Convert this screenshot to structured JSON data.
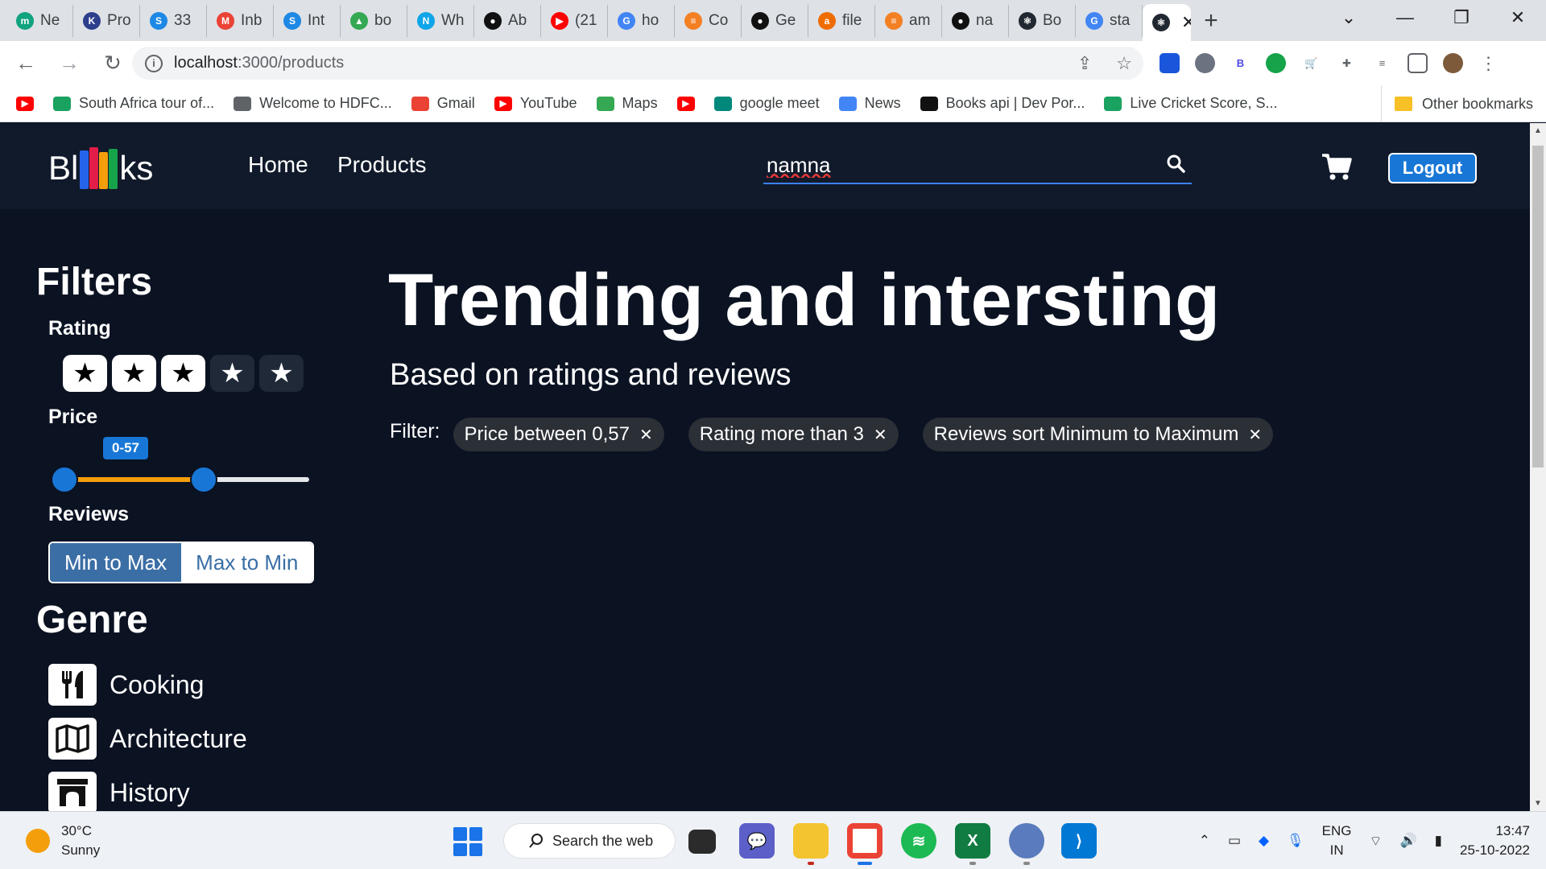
{
  "browser": {
    "tabs": [
      {
        "label": "Ne",
        "icon": "m-icon",
        "color": "#10a37f",
        "glyph": "m"
      },
      {
        "label": "Pro",
        "icon": "k-icon",
        "color": "#2c3e8c",
        "glyph": "K"
      },
      {
        "label": "33",
        "icon": "s-icon",
        "color": "#1e88e5",
        "glyph": "S"
      },
      {
        "label": "Inb",
        "icon": "gmail-icon",
        "color": "#ea4335",
        "glyph": "M"
      },
      {
        "label": "Int",
        "icon": "s-icon",
        "color": "#1e88e5",
        "glyph": "S"
      },
      {
        "label": "bo",
        "icon": "drive-icon",
        "color": "#34a853",
        "glyph": "▲"
      },
      {
        "label": "Wh",
        "icon": "n-icon",
        "color": "#0ea5e9",
        "glyph": "N"
      },
      {
        "label": "Ab",
        "icon": "github-icon",
        "color": "#111111",
        "glyph": "●"
      },
      {
        "label": "(21",
        "icon": "youtube-icon",
        "color": "#ff0000",
        "glyph": "▶"
      },
      {
        "label": "ho",
        "icon": "google-icon",
        "color": "#4285f4",
        "glyph": "G"
      },
      {
        "label": "Co",
        "icon": "stackoverflow-icon",
        "color": "#f48024",
        "glyph": "≡"
      },
      {
        "label": "Ge",
        "icon": "github-icon",
        "color": "#111111",
        "glyph": "●"
      },
      {
        "label": "file",
        "icon": "ask-icon",
        "color": "#ef6c00",
        "glyph": "a"
      },
      {
        "label": "am",
        "icon": "stackoverflow-icon",
        "color": "#f48024",
        "glyph": "≡"
      },
      {
        "label": "na",
        "icon": "github-icon",
        "color": "#111111",
        "glyph": "●"
      },
      {
        "label": "Bo",
        "icon": "react-icon",
        "color": "#222831",
        "glyph": "⚛"
      },
      {
        "label": "sta",
        "icon": "google-icon",
        "color": "#4285f4",
        "glyph": "G"
      }
    ],
    "active_tab_icon": "react-icon",
    "url_host": "localhost",
    "url_path": ":3000/products",
    "bookmarks": [
      {
        "label": "",
        "icon": "youtube-icon",
        "color": "#ff0000"
      },
      {
        "label": "South Africa tour of...",
        "icon": "cricbuzz-icon",
        "color": "#1aa260"
      },
      {
        "label": "Welcome to HDFC...",
        "icon": "globe-icon",
        "color": "#5f6368"
      },
      {
        "label": "Gmail",
        "icon": "gmail-icon",
        "color": "#ea4335"
      },
      {
        "label": "YouTube",
        "icon": "youtube-icon",
        "color": "#ff0000"
      },
      {
        "label": "Maps",
        "icon": "maps-icon",
        "color": "#34a853"
      },
      {
        "label": "",
        "icon": "youtube-icon",
        "color": "#ff0000"
      },
      {
        "label": "google meet",
        "icon": "meet-icon",
        "color": "#00897b"
      },
      {
        "label": "News",
        "icon": "news-icon",
        "color": "#4285f4"
      },
      {
        "label": "Books api | Dev Por...",
        "icon": "nyt-icon",
        "color": "#111111"
      },
      {
        "label": "Live Cricket Score, S...",
        "icon": "cricbuzz-icon",
        "color": "#1aa260"
      }
    ],
    "other_bookmarks": "Other bookmarks"
  },
  "app": {
    "logo_left": "Bl",
    "logo_right": "ks",
    "nav": [
      "Home",
      "Products"
    ],
    "search_value": "namna",
    "logout_label": "Logout"
  },
  "filters": {
    "title": "Filters",
    "rating_label": "Rating",
    "rating_value": 3,
    "rating_max": 5,
    "price_label": "Price",
    "price_badge": "0-57",
    "price_fraction_low": 0.0,
    "price_fraction_high": 0.57,
    "reviews_label": "Reviews",
    "sort_options": [
      "Min to Max",
      "Max to Min"
    ],
    "genre_title": "Genre",
    "genres": [
      {
        "label": "Cooking",
        "icon": "utensils-icon"
      },
      {
        "label": "Architecture",
        "icon": "map-icon"
      },
      {
        "label": "History",
        "icon": "archway-icon"
      }
    ]
  },
  "main": {
    "title": "Trending and intersting",
    "subtitle": "Based on ratings and reviews",
    "filter_label": "Filter:",
    "chips": [
      "Price between 0,57",
      "Rating more than 3",
      "Reviews sort Minimum to Maximum"
    ]
  },
  "taskbar": {
    "weather_temp": "30°C",
    "weather_desc": "Sunny",
    "search_label": "Search the web",
    "lang_1": "ENG",
    "lang_2": "IN",
    "time": "13:47",
    "date": "25-10-2022"
  }
}
